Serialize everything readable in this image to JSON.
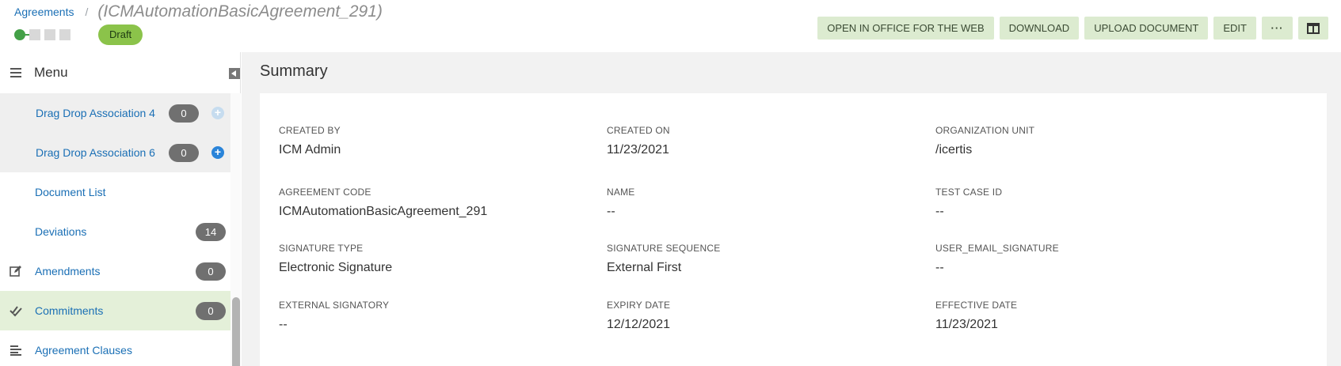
{
  "header": {
    "breadcrumb_link": "Agreements",
    "breadcrumb_sep": "/",
    "record_title": "(ICMAutomationBasicAgreement_291)",
    "status": "Draft",
    "toolbar": {
      "open_office": "OPEN IN OFFICE FOR THE WEB",
      "download": "DOWNLOAD",
      "upload": "UPLOAD DOCUMENT",
      "edit": "EDIT",
      "more": "···"
    }
  },
  "sidebar": {
    "menu_label": "Menu",
    "items": [
      {
        "label": "Drag Drop Association 4",
        "count": "0"
      },
      {
        "label": "Drag Drop Association 6",
        "count": "0"
      },
      {
        "label": "Document List"
      },
      {
        "label": "Deviations",
        "count": "14"
      },
      {
        "label": "Amendments",
        "count": "0",
        "icon": "edit-icon"
      },
      {
        "label": "Commitments",
        "count": "0",
        "icon": "double-check-icon"
      },
      {
        "label": "Agreement Clauses",
        "icon": "align-left-icon"
      }
    ]
  },
  "main": {
    "title": "Summary",
    "fields": [
      {
        "label": "CREATED BY",
        "value": "ICM Admin"
      },
      {
        "label": "CREATED ON",
        "value": "11/23/2021"
      },
      {
        "label": "ORGANIZATION UNIT",
        "value": "/icertis"
      },
      {
        "label": "AGREEMENT CODE",
        "value": "ICMAutomationBasicAgreement_291"
      },
      {
        "label": "NAME",
        "value": "--"
      },
      {
        "label": "TEST CASE ID",
        "value": "--"
      },
      {
        "label": "SIGNATURE TYPE",
        "value": "Electronic Signature"
      },
      {
        "label": "SIGNATURE SEQUENCE",
        "value": "External First"
      },
      {
        "label": "USER_EMAIL_SIGNATURE",
        "value": "--"
      },
      {
        "label": "EXTERNAL SIGNATORY",
        "value": "--"
      },
      {
        "label": "EXPIRY DATE",
        "value": "12/12/2021"
      },
      {
        "label": "EFFECTIVE DATE",
        "value": "11/23/2021"
      }
    ]
  },
  "colors": {
    "accent_link": "#1a6fb5",
    "status_green": "#8bc34a",
    "toolbar_button_bg": "#dcebd0",
    "active_nav_bg": "#e4f0d9"
  }
}
